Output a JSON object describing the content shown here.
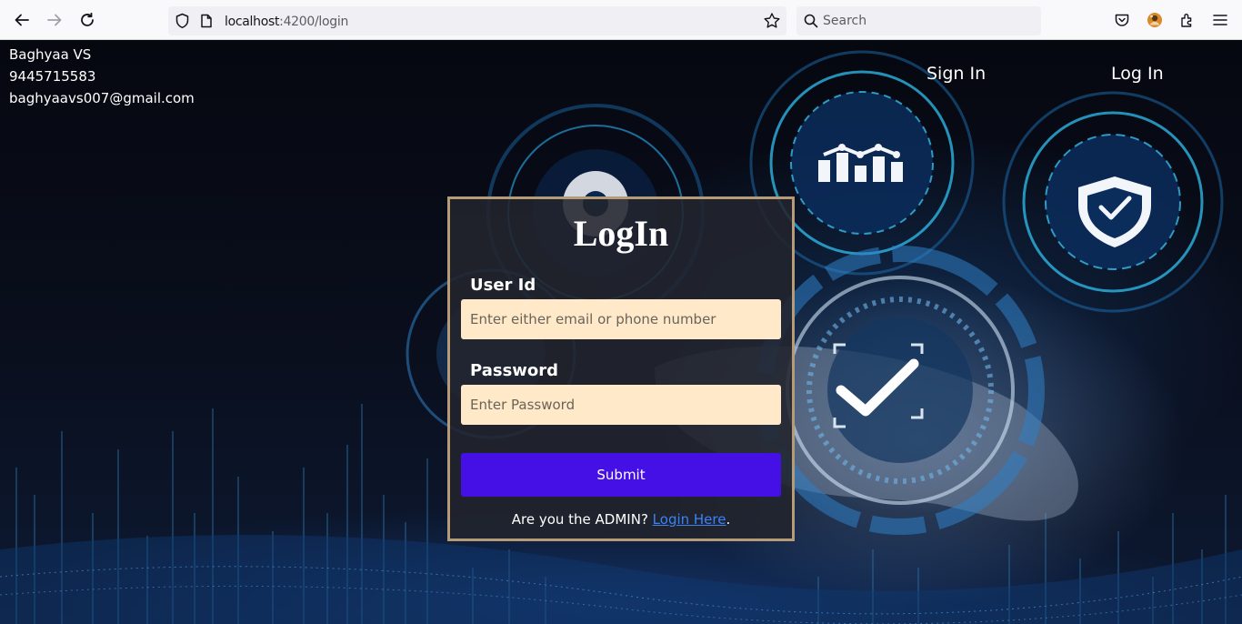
{
  "browser": {
    "url_host": "localhost",
    "url_path": ":4200/login",
    "search_placeholder": "Search"
  },
  "header": {
    "name": "Baghyaa VS",
    "phone": "9445715583",
    "email": "baghyaavs007@gmail.com",
    "sign_in": "Sign In",
    "log_in": "Log In"
  },
  "login": {
    "title": "LogIn",
    "user_label": "User Id",
    "user_placeholder": "Enter either email or phone number",
    "password_label": "Password",
    "password_placeholder": "Enter Password",
    "submit": "Submit",
    "admin_prefix": "Are you the ADMIN? ",
    "admin_link": "Login Here",
    "admin_suffix": "."
  },
  "colors": {
    "card_border": "#b59c77",
    "input_bg": "#ffe9c9",
    "submit_bg": "#4510e6",
    "link": "#3b82f6"
  }
}
